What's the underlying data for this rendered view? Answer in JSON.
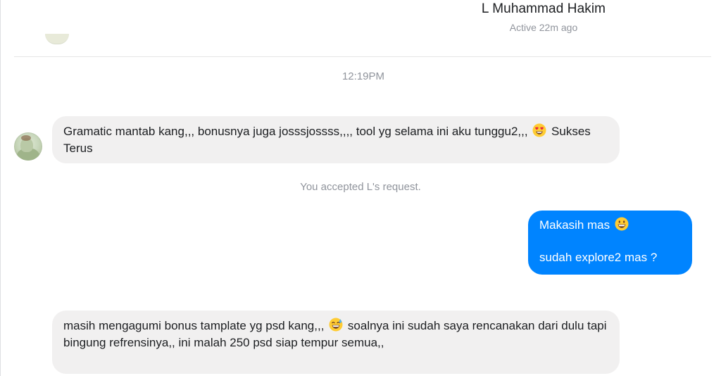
{
  "header": {
    "contact_name": "L Muhammad Hakim",
    "status": "Active 22m ago"
  },
  "conversation": {
    "timestamp": "12:19PM",
    "system_note": "You accepted L's request.",
    "messages": [
      {
        "direction": "incoming",
        "text_before_emoji": "Gramatic mantab kang,,, bonusnya juga josssjossss,,,, tool yg selama ini aku tunggu2,,,",
        "emoji": "heart-eyes-emoji",
        "text_after_emoji": "Sukses Terus"
      },
      {
        "direction": "outgoing",
        "line1_text": "Makasih mas",
        "line1_emoji": "grinning-emoji",
        "line2_text": "sudah explore2 mas ?"
      },
      {
        "direction": "incoming",
        "text_before_emoji": "masih mengagumi bonus tamplate yg psd kang,,,",
        "emoji": "sweat-smile-emoji",
        "text_after_emoji": "soalnya ini sudah saya rencanakan dari dulu tapi bingung refrensinya,, ini malah 250 psd siap tempur semua,,"
      }
    ]
  },
  "colors": {
    "outgoing_bubble": "#0084ff",
    "incoming_bubble": "#f1f0f0",
    "muted_text": "#90949c"
  }
}
